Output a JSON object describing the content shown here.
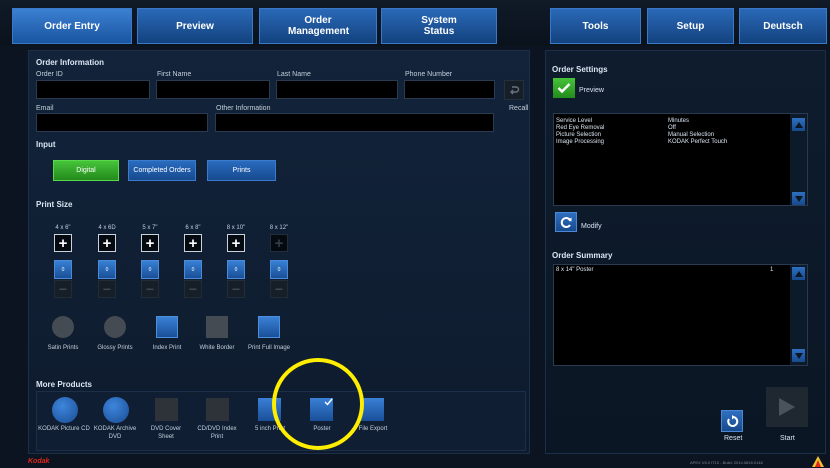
{
  "nav": {
    "order_entry": "Order Entry",
    "preview": "Preview",
    "order_management": "Order Management",
    "system_status": "System Status",
    "tools": "Tools",
    "setup": "Setup",
    "language": "Deutsch"
  },
  "order_info": {
    "title": "Order Information",
    "order_id_label": "Order ID",
    "first_name_label": "First Name",
    "last_name_label": "Last Name",
    "phone_label": "Phone Number",
    "email_label": "Email",
    "other_info_label": "Other Information",
    "recall_label": "Recall",
    "order_id_value": "",
    "first_name_value": "",
    "last_name_value": "",
    "phone_value": "",
    "email_value": "",
    "other_info_value": ""
  },
  "input": {
    "title": "Input",
    "digital": "Digital",
    "completed_orders": "Completed Orders",
    "prints": "Prints"
  },
  "print_size": {
    "title": "Print Size",
    "sizes": [
      {
        "label": "4 x 6\"",
        "count": "0"
      },
      {
        "label": "4 x 6D",
        "count": "0"
      },
      {
        "label": "5 x 7\"",
        "count": "0"
      },
      {
        "label": "6 x 8\"",
        "count": "0"
      },
      {
        "label": "8 x 10\"",
        "count": "0"
      },
      {
        "label": "8 x 12\"",
        "count": "0"
      }
    ],
    "options": [
      "Satin Prints",
      "Glossy Prints",
      "Index Print",
      "White Border",
      "Print Full Image"
    ]
  },
  "more_products": {
    "title": "More Products",
    "items": [
      "KODAK Picture CD",
      "KODAK Archive DVD",
      "DVD Cover Sheet",
      "CD/DVD Index Print",
      "5 inch Print",
      "Poster",
      "File Export"
    ],
    "selected": "Poster"
  },
  "order_settings": {
    "title": "Order Settings",
    "preview_label": "Preview",
    "preview_checked": true,
    "settings": [
      {
        "name": "Service Level",
        "value": "Minutes"
      },
      {
        "name": "Red Eye Removal",
        "value": "Off"
      },
      {
        "name": "Picture Selection",
        "value": "Manual Selection"
      },
      {
        "name": "Image Processing",
        "value": "KODAK Perfect Touch"
      }
    ],
    "modify_label": "Modify"
  },
  "order_summary": {
    "title": "Order Summary",
    "rows": [
      {
        "item": "8 x 14\" Poster",
        "qty": "1"
      }
    ]
  },
  "actions": {
    "reset": "Reset",
    "start": "Start"
  },
  "footer": {
    "brand": "Kodak",
    "version": "APEX V6.0 IT10 - Build: 2014.0818.0148"
  },
  "colors": {
    "accent_blue": "#2a69b8",
    "active_green": "#46c43a",
    "brand_red": "#e0261a",
    "highlight_yellow": "#ffee00"
  }
}
